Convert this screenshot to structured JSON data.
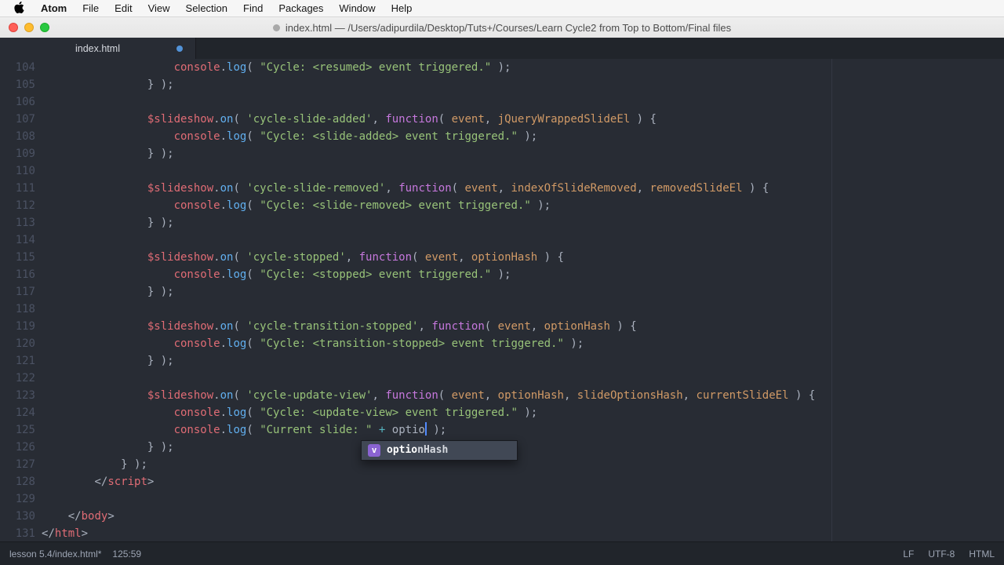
{
  "menu_bar": {
    "items": [
      "Atom",
      "File",
      "Edit",
      "View",
      "Selection",
      "Find",
      "Packages",
      "Window",
      "Help"
    ]
  },
  "window": {
    "title": "index.html — /Users/adipurdila/Desktop/Tuts+/Courses/Learn Cycle2 from Top to Bottom/Final files"
  },
  "tabs": [
    {
      "label": "index.html",
      "modified": true
    }
  ],
  "editor": {
    "cursor": {
      "line": 125,
      "column": 59
    },
    "autocomplete": {
      "type_icon": "v",
      "match": "optio",
      "rest": "nHash",
      "suggestion": "optionHash"
    },
    "lines": [
      {
        "n": 104,
        "i": 20,
        "t": [
          [
            "v",
            "console"
          ],
          [
            "pu",
            "."
          ],
          [
            "fn",
            "log"
          ],
          [
            "pu",
            "( "
          ],
          [
            "str",
            "\"Cycle: <resumed> event triggered.\""
          ],
          [
            "pu",
            " );"
          ]
        ]
      },
      {
        "n": 105,
        "i": 16,
        "t": [
          [
            "pu",
            "} );"
          ]
        ]
      },
      {
        "n": 106,
        "i": 0,
        "t": []
      },
      {
        "n": 107,
        "i": 16,
        "t": [
          [
            "v",
            "$slideshow"
          ],
          [
            "pu",
            "."
          ],
          [
            "fn",
            "on"
          ],
          [
            "pu",
            "( "
          ],
          [
            "str",
            "'cycle-slide-added'"
          ],
          [
            "pu",
            ", "
          ],
          [
            "kw",
            "function"
          ],
          [
            "pu",
            "( "
          ],
          [
            "arg",
            "event"
          ],
          [
            "pu",
            ", "
          ],
          [
            "arg",
            "jQueryWrappedSlideEl"
          ],
          [
            "pu",
            " ) {"
          ]
        ]
      },
      {
        "n": 108,
        "i": 20,
        "t": [
          [
            "v",
            "console"
          ],
          [
            "pu",
            "."
          ],
          [
            "fn",
            "log"
          ],
          [
            "pu",
            "( "
          ],
          [
            "str",
            "\"Cycle: <slide-added> event triggered.\""
          ],
          [
            "pu",
            " );"
          ]
        ]
      },
      {
        "n": 109,
        "i": 16,
        "t": [
          [
            "pu",
            "} );"
          ]
        ]
      },
      {
        "n": 110,
        "i": 0,
        "t": []
      },
      {
        "n": 111,
        "i": 16,
        "t": [
          [
            "v",
            "$slideshow"
          ],
          [
            "pu",
            "."
          ],
          [
            "fn",
            "on"
          ],
          [
            "pu",
            "( "
          ],
          [
            "str",
            "'cycle-slide-removed'"
          ],
          [
            "pu",
            ", "
          ],
          [
            "kw",
            "function"
          ],
          [
            "pu",
            "( "
          ],
          [
            "arg",
            "event"
          ],
          [
            "pu",
            ", "
          ],
          [
            "arg",
            "indexOfSlideRemoved"
          ],
          [
            "pu",
            ", "
          ],
          [
            "arg",
            "removedSlideEl"
          ],
          [
            "pu",
            " ) {"
          ]
        ]
      },
      {
        "n": 112,
        "i": 20,
        "t": [
          [
            "v",
            "console"
          ],
          [
            "pu",
            "."
          ],
          [
            "fn",
            "log"
          ],
          [
            "pu",
            "( "
          ],
          [
            "str",
            "\"Cycle: <slide-removed> event triggered.\""
          ],
          [
            "pu",
            " );"
          ]
        ]
      },
      {
        "n": 113,
        "i": 16,
        "t": [
          [
            "pu",
            "} );"
          ]
        ]
      },
      {
        "n": 114,
        "i": 0,
        "t": []
      },
      {
        "n": 115,
        "i": 16,
        "t": [
          [
            "v",
            "$slideshow"
          ],
          [
            "pu",
            "."
          ],
          [
            "fn",
            "on"
          ],
          [
            "pu",
            "( "
          ],
          [
            "str",
            "'cycle-stopped'"
          ],
          [
            "pu",
            ", "
          ],
          [
            "kw",
            "function"
          ],
          [
            "pu",
            "( "
          ],
          [
            "arg",
            "event"
          ],
          [
            "pu",
            ", "
          ],
          [
            "arg",
            "optionHash"
          ],
          [
            "pu",
            " ) {"
          ]
        ]
      },
      {
        "n": 116,
        "i": 20,
        "t": [
          [
            "v",
            "console"
          ],
          [
            "pu",
            "."
          ],
          [
            "fn",
            "log"
          ],
          [
            "pu",
            "( "
          ],
          [
            "str",
            "\"Cycle: <stopped> event triggered.\""
          ],
          [
            "pu",
            " );"
          ]
        ]
      },
      {
        "n": 117,
        "i": 16,
        "t": [
          [
            "pu",
            "} );"
          ]
        ]
      },
      {
        "n": 118,
        "i": 0,
        "t": []
      },
      {
        "n": 119,
        "i": 16,
        "t": [
          [
            "v",
            "$slideshow"
          ],
          [
            "pu",
            "."
          ],
          [
            "fn",
            "on"
          ],
          [
            "pu",
            "( "
          ],
          [
            "str",
            "'cycle-transition-stopped'"
          ],
          [
            "pu",
            ", "
          ],
          [
            "kw",
            "function"
          ],
          [
            "pu",
            "( "
          ],
          [
            "arg",
            "event"
          ],
          [
            "pu",
            ", "
          ],
          [
            "arg",
            "optionHash"
          ],
          [
            "pu",
            " ) {"
          ]
        ]
      },
      {
        "n": 120,
        "i": 20,
        "t": [
          [
            "v",
            "console"
          ],
          [
            "pu",
            "."
          ],
          [
            "fn",
            "log"
          ],
          [
            "pu",
            "( "
          ],
          [
            "str",
            "\"Cycle: <transition-stopped> event triggered.\""
          ],
          [
            "pu",
            " );"
          ]
        ]
      },
      {
        "n": 121,
        "i": 16,
        "t": [
          [
            "pu",
            "} );"
          ]
        ]
      },
      {
        "n": 122,
        "i": 0,
        "t": []
      },
      {
        "n": 123,
        "i": 16,
        "t": [
          [
            "v",
            "$slideshow"
          ],
          [
            "pu",
            "."
          ],
          [
            "fn",
            "on"
          ],
          [
            "pu",
            "( "
          ],
          [
            "str",
            "'cycle-update-view'"
          ],
          [
            "pu",
            ", "
          ],
          [
            "kw",
            "function"
          ],
          [
            "pu",
            "( "
          ],
          [
            "arg",
            "event"
          ],
          [
            "pu",
            ", "
          ],
          [
            "arg",
            "optionHash"
          ],
          [
            "pu",
            ", "
          ],
          [
            "arg",
            "slideOptionsHash"
          ],
          [
            "pu",
            ", "
          ],
          [
            "arg",
            "currentSlideEl"
          ],
          [
            "pu",
            " ) {"
          ]
        ]
      },
      {
        "n": 124,
        "i": 20,
        "t": [
          [
            "v",
            "console"
          ],
          [
            "pu",
            "."
          ],
          [
            "fn",
            "log"
          ],
          [
            "pu",
            "( "
          ],
          [
            "str",
            "\"Cycle: <update-view> event triggered.\""
          ],
          [
            "pu",
            " );"
          ]
        ]
      },
      {
        "n": 125,
        "i": 20,
        "t": [
          [
            "v",
            "console"
          ],
          [
            "pu",
            "."
          ],
          [
            "fn",
            "log"
          ],
          [
            "pu",
            "( "
          ],
          [
            "str",
            "\"Current slide: \""
          ],
          [
            "pu",
            " "
          ],
          [
            "op",
            "+"
          ],
          [
            "pu",
            " "
          ],
          [
            "pl",
            "optio"
          ],
          [
            "cursor",
            ""
          ],
          [
            "pu",
            " );"
          ]
        ]
      },
      {
        "n": 126,
        "i": 16,
        "t": [
          [
            "pu",
            "} );"
          ]
        ]
      },
      {
        "n": 127,
        "i": 12,
        "t": [
          [
            "pu",
            "} );"
          ]
        ]
      },
      {
        "n": 128,
        "i": 8,
        "t": [
          [
            "pu",
            "<"
          ],
          [
            "pu",
            "/"
          ],
          [
            "tag",
            "script"
          ],
          [
            "pu",
            ">"
          ]
        ]
      },
      {
        "n": 129,
        "i": 0,
        "t": []
      },
      {
        "n": 130,
        "i": 4,
        "t": [
          [
            "pu",
            "<"
          ],
          [
            "pu",
            "/"
          ],
          [
            "tag",
            "body"
          ],
          [
            "pu",
            ">"
          ]
        ]
      },
      {
        "n": 131,
        "i": 0,
        "t": [
          [
            "pu",
            "<"
          ],
          [
            "pu",
            "/"
          ],
          [
            "tag",
            "html"
          ],
          [
            "pu",
            ">"
          ]
        ]
      }
    ]
  },
  "status_bar": {
    "file": "lesson 5.4/index.html*",
    "cursor": "125:59",
    "line_ending": "LF",
    "encoding": "UTF-8",
    "grammar": "HTML"
  }
}
